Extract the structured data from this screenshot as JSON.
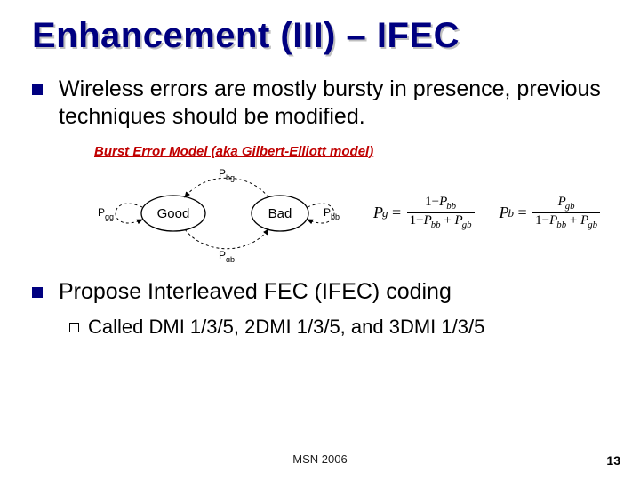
{
  "title": "Enhancement (III) – IFEC",
  "bullets": [
    "Wireless errors are mostly bursty in presence, previous techniques should be modified.",
    "Propose Interleaved FEC (IFEC) coding"
  ],
  "model_label": "Burst Error Model (aka Gilbert-Elliott model)",
  "states": {
    "good": "Good",
    "bad": "Bad"
  },
  "probs": {
    "pgg": "P",
    "pbg": "P",
    "pgb": "P",
    "pbb": "P"
  },
  "prob_subs": {
    "gg": "gg",
    "bg": "bg",
    "gb": "gb",
    "bb": "bb"
  },
  "formulas": {
    "pg_lhs": "P",
    "pg_sub": "g",
    "pg_num_l": "1−",
    "pg_num_r": "P",
    "pg_num_sub": "bb",
    "pg_den_l": "1−",
    "pg_den_r1": "P",
    "pg_den_s1": "bb",
    "pg_den_plus": "+",
    "pg_den_r2": "P",
    "pg_den_s2": "gb",
    "pb_lhs": "P",
    "pb_sub": "b",
    "pb_num_r": "P",
    "pb_num_sub": "gb",
    "pb_den_l": "1−",
    "pb_den_r1": "P",
    "pb_den_s1": "bb",
    "pb_den_plus": "+",
    "pb_den_r2": "P",
    "pb_den_s2": "gb"
  },
  "sub_bullet_prefix": "Called",
  "sub_bullet_rest": " DMI 1/3/5, 2DMI 1/3/5, and 3DMI 1/3/5",
  "footer_center": "MSN 2006",
  "footer_right": "13"
}
